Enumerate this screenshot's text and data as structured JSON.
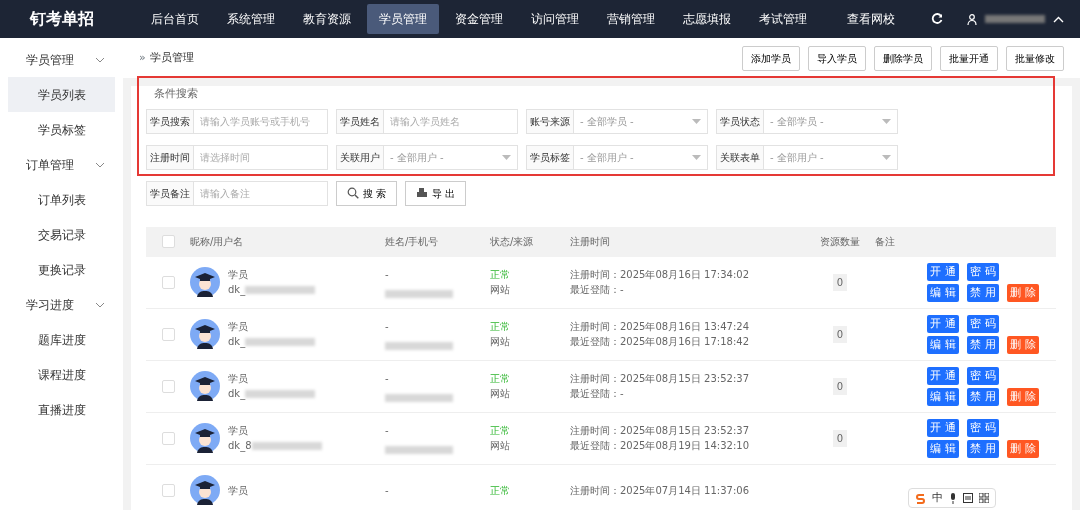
{
  "brand": "钉考单招",
  "nav": [
    {
      "label": "后台首页",
      "selected": false
    },
    {
      "label": "系统管理",
      "selected": false
    },
    {
      "label": "教育资源",
      "selected": false
    },
    {
      "label": "学员管理",
      "selected": true
    },
    {
      "label": "资金管理",
      "selected": false
    },
    {
      "label": "访问管理",
      "selected": false
    },
    {
      "label": "营销管理",
      "selected": false
    },
    {
      "label": "志愿填报",
      "selected": false
    },
    {
      "label": "考试管理",
      "selected": false
    }
  ],
  "nav_right": {
    "link": "查看网校"
  },
  "sidebar": [
    {
      "label": "学员管理",
      "expanded": true,
      "children": [
        {
          "label": "学员列表",
          "selected": true
        },
        {
          "label": "学员标签",
          "selected": false
        }
      ]
    },
    {
      "label": "订单管理",
      "expanded": true,
      "children": [
        {
          "label": "订单列表",
          "selected": false
        },
        {
          "label": "交易记录",
          "selected": false
        },
        {
          "label": "更换记录",
          "selected": false
        }
      ]
    },
    {
      "label": "学习进度",
      "expanded": true,
      "children": [
        {
          "label": "题库进度",
          "selected": false
        },
        {
          "label": "课程进度",
          "selected": false
        },
        {
          "label": "直播进度",
          "selected": false
        }
      ]
    }
  ],
  "breadcrumb_separator": "»",
  "breadcrumb": "学员管理",
  "toolbar_buttons": [
    "添加学员",
    "导入学员",
    "删除学员",
    "批量开通",
    "批量修改"
  ],
  "search": {
    "title": "条件搜索",
    "fields": [
      {
        "label": "学员搜索",
        "placeholder": "请输入学员账号或手机号",
        "kind": "text"
      },
      {
        "label": "学员姓名",
        "placeholder": "请输入学员姓名",
        "kind": "text"
      },
      {
        "label": "账号来源",
        "value": "- 全部学员 -",
        "kind": "select"
      },
      {
        "label": "学员状态",
        "value": "- 全部学员 -",
        "kind": "select"
      },
      {
        "label": "注册时间",
        "placeholder": "请选择时间",
        "kind": "text"
      },
      {
        "label": "关联用户",
        "value": "- 全部用户 -",
        "kind": "select"
      },
      {
        "label": "学员标签",
        "value": "- 全部用户 -",
        "kind": "select"
      },
      {
        "label": "关联表单",
        "value": "- 全部用户 -",
        "kind": "select"
      },
      {
        "label": "学员备注",
        "placeholder": "请输入备注",
        "kind": "text"
      }
    ],
    "buttons": [
      {
        "label": "搜 索",
        "kind": "search"
      },
      {
        "label": "导 出",
        "kind": "export"
      }
    ]
  },
  "table": {
    "header_checked": false,
    "columns": [
      "昵称/用户名",
      "姓名/手机号",
      "状态/来源",
      "注册时间",
      "资源数量",
      "备注"
    ],
    "rows": [
      {
        "checked": false,
        "nickname": "学员",
        "username": "dk_",
        "name": "-",
        "status": "正常",
        "source": "网站",
        "registered": "注册时间：2025年08月16日 17:34:02",
        "last_login": "最近登陆：-",
        "resources": "0",
        "actions": [
          {
            "label": "开 通",
            "kind": "primary"
          },
          {
            "label": "密 码",
            "kind": "primary"
          },
          {
            "label": "编 辑",
            "kind": "primary"
          },
          {
            "label": "禁 用",
            "kind": "primary"
          },
          {
            "label": "删 除",
            "kind": "danger"
          }
        ]
      },
      {
        "checked": false,
        "nickname": "学员",
        "username": "dk_",
        "name": "-",
        "status": "正常",
        "source": "网站",
        "registered": "注册时间：2025年08月16日 13:47:24",
        "last_login": "最近登陆：2025年08月16日 17:18:42",
        "resources": "0",
        "actions": [
          {
            "label": "开 通",
            "kind": "primary"
          },
          {
            "label": "密 码",
            "kind": "primary"
          },
          {
            "label": "编 辑",
            "kind": "primary"
          },
          {
            "label": "禁 用",
            "kind": "primary"
          },
          {
            "label": "删 除",
            "kind": "danger"
          }
        ]
      },
      {
        "checked": false,
        "nickname": "学员",
        "username": "dk_",
        "name": "-",
        "status": "正常",
        "source": "网站",
        "registered": "注册时间：2025年08月15日 23:52:37",
        "last_login": "最近登陆：-",
        "resources": "0",
        "actions": [
          {
            "label": "开 通",
            "kind": "primary"
          },
          {
            "label": "密 码",
            "kind": "primary"
          },
          {
            "label": "编 辑",
            "kind": "primary"
          },
          {
            "label": "禁 用",
            "kind": "primary"
          },
          {
            "label": "删 除",
            "kind": "danger"
          }
        ]
      },
      {
        "checked": false,
        "nickname": "学员",
        "username": "dk_8",
        "name": "-",
        "status": "正常",
        "source": "网站",
        "registered": "注册时间：2025年08月15日 23:52:37",
        "last_login": "最近登陆：2025年08月19日 14:32:10",
        "resources": "0",
        "actions": [
          {
            "label": "开 通",
            "kind": "primary"
          },
          {
            "label": "密 码",
            "kind": "primary"
          },
          {
            "label": "编 辑",
            "kind": "primary"
          },
          {
            "label": "禁 用",
            "kind": "primary"
          },
          {
            "label": "删 除",
            "kind": "danger"
          }
        ]
      },
      {
        "checked": false,
        "nickname": "学员",
        "name": "-",
        "status": "正常",
        "registered": "注册时间：2025年07月14日 11:37:06"
      }
    ]
  },
  "ime_toolbar": {
    "label": "中"
  }
}
